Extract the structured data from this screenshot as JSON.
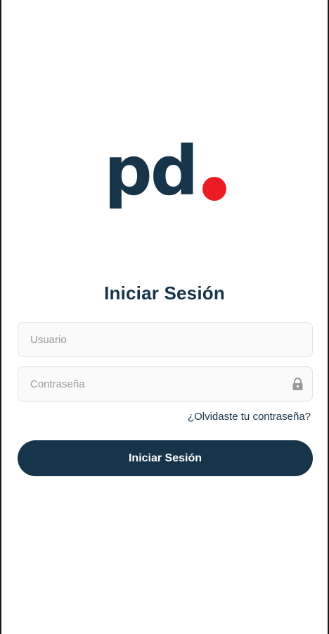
{
  "brand": {
    "logo_text": "pd",
    "dot_color": "#ec1c24",
    "primary_color": "#16344a"
  },
  "login": {
    "title": "Iniciar Sesión",
    "username": {
      "value": "",
      "placeholder": "Usuario"
    },
    "password": {
      "value": "",
      "placeholder": "Contraseña",
      "icon": "lock-icon"
    },
    "forgot_password_label": "¿Olvidaste tu contraseña?",
    "submit_label": "Iniciar Sesión"
  }
}
